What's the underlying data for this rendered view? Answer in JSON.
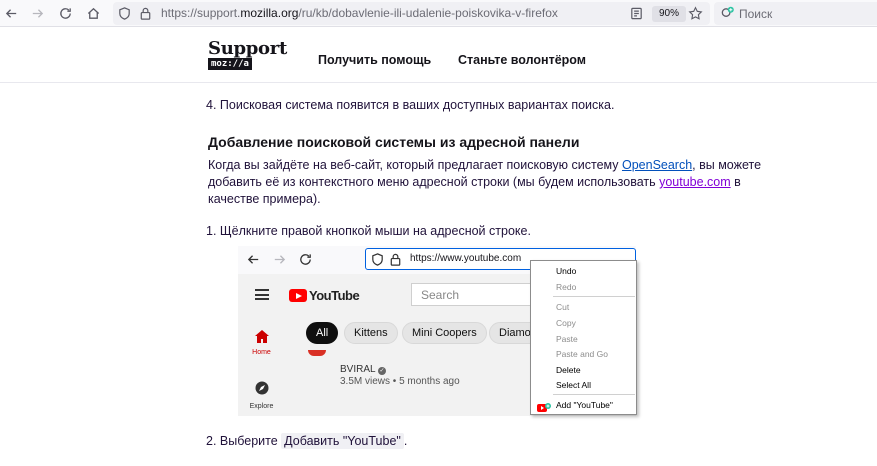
{
  "browser": {
    "url_prefix": "https://support.",
    "url_domain": "mozilla.org",
    "url_path": "/ru/kb/dobavlenie-ili-udalenie-poiskovika-v-firefox",
    "zoom": "90%",
    "search_placeholder": "Поиск"
  },
  "site": {
    "logo_text": "Support",
    "logo_sub": "moz://a",
    "nav": [
      "Получить помощь",
      "Станьте волонтёром"
    ]
  },
  "article": {
    "step4": "4. Поисковая система появится в ваших доступных вариантах поиска.",
    "heading": "Добавление поисковой системы из адресной панели",
    "para_line1_a": "Когда вы зайдёте на веб-сайт, который предлагает поисковую систему ",
    "para_link_opensearch": "OpenSearch",
    "para_line1_b": ", вы можете",
    "para_line2_a": "добавить её из контекстного меню адресной строки (мы будем использовать ",
    "para_link_youtube": "youtube.com",
    "para_line2_b": " в",
    "para_line3": "качестве примера).",
    "step1": "1. Щёлкните правой кнопкой мыши на адресной строке.",
    "step2_a": "2. Выберите ",
    "step2_kbd": "Добавить \"YouTube\"",
    "step2_b": "."
  },
  "screenshot": {
    "url": "https://www.youtube.com",
    "yt_word": "YouTube",
    "search_placeholder": "Search",
    "chips": [
      "All",
      "Kittens",
      "Mini Coopers",
      "Diamon"
    ],
    "side": [
      {
        "label": "Home"
      },
      {
        "label": "Explore"
      }
    ],
    "channel": "BVIRAL",
    "meta": "3.5M views • 5 months ago"
  },
  "context_menu": {
    "items": [
      {
        "label": "Undo",
        "disabled": false
      },
      {
        "label": "Redo",
        "disabled": true
      },
      {
        "label": "Cut",
        "disabled": true
      },
      {
        "label": "Copy",
        "disabled": true
      },
      {
        "label": "Paste",
        "disabled": true
      },
      {
        "label": "Paste and Go",
        "disabled": true
      },
      {
        "label": "Delete",
        "disabled": false
      },
      {
        "label": "Select All",
        "disabled": false
      },
      {
        "label": "Add \"YouTube\"",
        "disabled": false
      }
    ]
  },
  "colors": {
    "link": "#0250bb",
    "visited_link": "#8000d7",
    "youtube_red": "#ff0000",
    "focus_blue": "#0061e0"
  }
}
